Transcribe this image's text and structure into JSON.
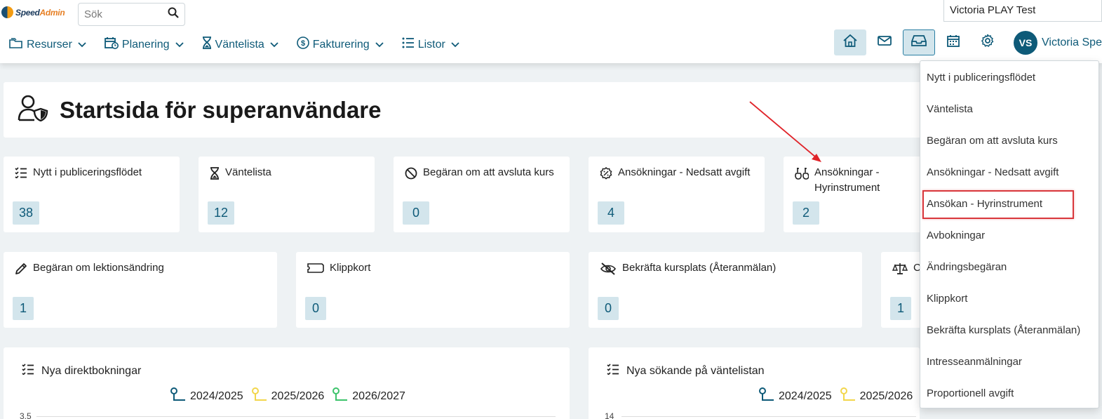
{
  "header": {
    "logo_speed": "Speed",
    "logo_admin": "Admin",
    "search_placeholder": "Sök",
    "organization": "Victoria PLAY Test",
    "user_initials": "VS",
    "user_name": "Victoria Spe"
  },
  "nav": [
    {
      "label": "Resurser",
      "icon": "folders-icon"
    },
    {
      "label": "Planering",
      "icon": "calendar-clock-icon"
    },
    {
      "label": "Väntelista",
      "icon": "hourglass-icon"
    },
    {
      "label": "Fakturering",
      "icon": "dollar-circle-icon"
    },
    {
      "label": "Listor",
      "icon": "list-icon"
    }
  ],
  "actions": [
    "home-icon",
    "mail-icon",
    "inbox-icon",
    "calendar-icon",
    "gear-icon"
  ],
  "page": {
    "title": "Startsida för superanvändare"
  },
  "cards_row1": [
    {
      "label": "Nytt i publiceringsflödet",
      "value": "38",
      "icon": "checklist-icon"
    },
    {
      "label": "Väntelista",
      "value": "12",
      "icon": "hourglass-icon"
    },
    {
      "label": "Begäran om att avsluta kurs",
      "value": "0",
      "icon": "ban-icon"
    },
    {
      "label": "Ansökningar - Nedsatt avgift",
      "value": "4",
      "icon": "discount-icon"
    },
    {
      "label": "Ansökningar - Hyrinstrument",
      "value": "2",
      "icon": "guitar-icon"
    }
  ],
  "cards_row2": [
    {
      "label": "Begäran om lektionsändring",
      "value": "1",
      "icon": "pencil-icon"
    },
    {
      "label": "Klippkort",
      "value": "0",
      "icon": "ticket-icon"
    },
    {
      "label": "Bekräfta kursplats (Återanmälan)",
      "value": "0",
      "icon": "eye-slash-icon"
    },
    {
      "label": "C",
      "value": "1",
      "icon": "scale-icon"
    }
  ],
  "charts": [
    {
      "title": "Nya direktbokningar",
      "legend": [
        {
          "label": "2024/2025",
          "color": "#0e5a78"
        },
        {
          "label": "2025/2026",
          "color": "#f2d64b"
        },
        {
          "label": "2026/2027",
          "color": "#3cc36b"
        }
      ],
      "y_top_label": "3.5"
    },
    {
      "title": "Nya sökande på väntelistan",
      "legend": [
        {
          "label": "2024/2025",
          "color": "#0e5a78"
        },
        {
          "label": "2025/2026",
          "color": "#f2d64b"
        }
      ],
      "y_top_label": "14"
    }
  ],
  "dropdown": [
    "Nytt i publiceringsflödet",
    "Väntelista",
    "Begäran om att avsluta kurs",
    "Ansökningar - Nedsatt avgift",
    "Ansökan - Hyrinstrument",
    "Avbokningar",
    "Ändringsbegäran",
    "Klippkort",
    "Bekräfta kursplats (Återanmälan)",
    "Intresseanmälningar",
    "Proportionell avgift"
  ],
  "colors": {
    "primary": "#0e5a78",
    "badge_bg": "#d3e5ec",
    "annotation_red": "#d9373c"
  }
}
